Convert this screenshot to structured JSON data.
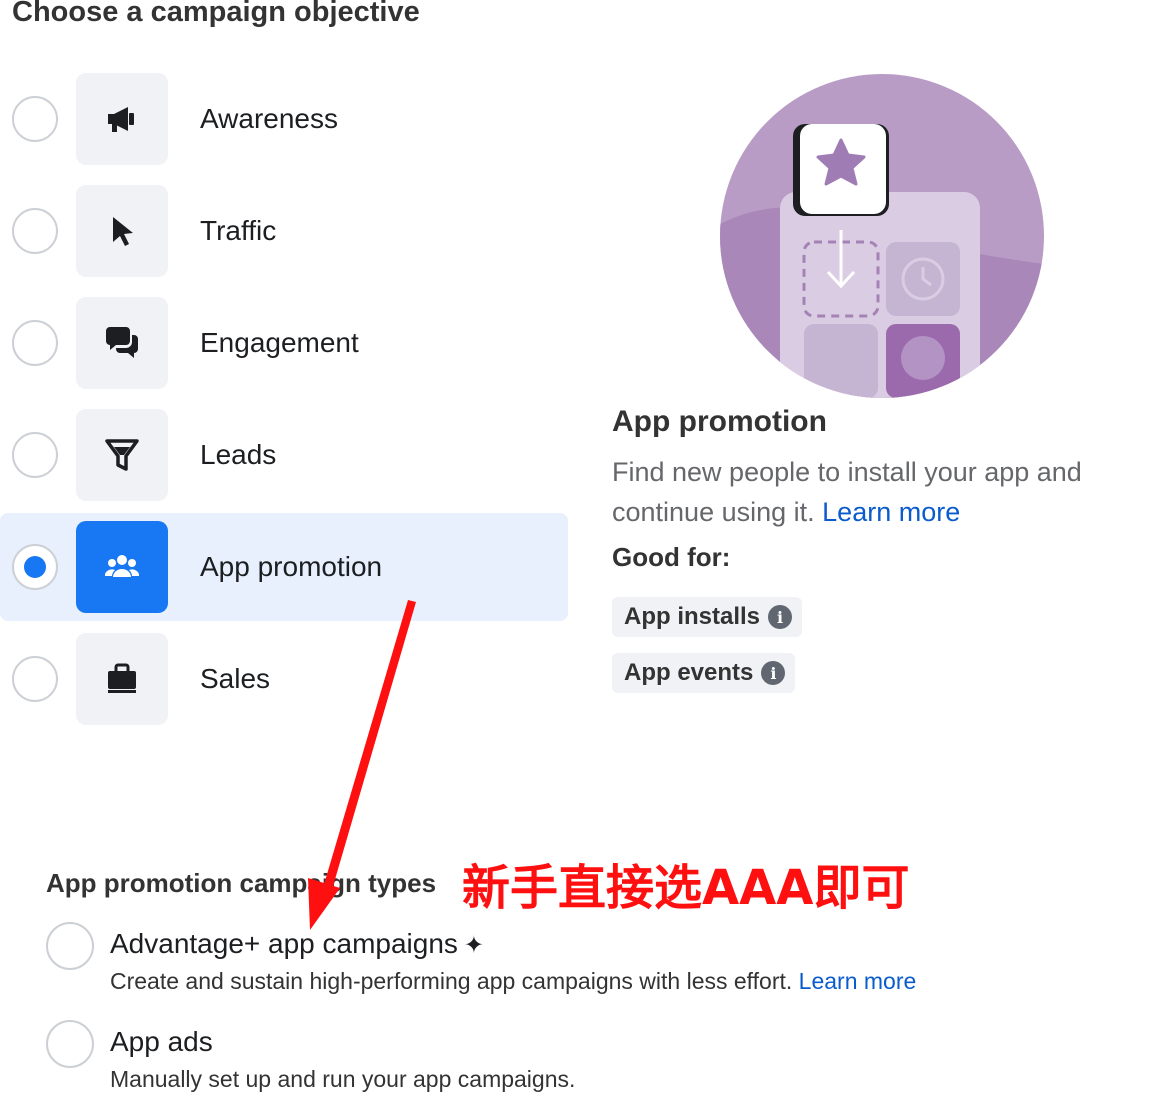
{
  "page": {
    "title": "Choose a campaign objective"
  },
  "objectives": [
    {
      "label": "Awareness",
      "icon": "megaphone-icon",
      "selected": false
    },
    {
      "label": "Traffic",
      "icon": "cursor-icon",
      "selected": false
    },
    {
      "label": "Engagement",
      "icon": "chat-bubbles-icon",
      "selected": false
    },
    {
      "label": "Leads",
      "icon": "funnel-icon",
      "selected": false
    },
    {
      "label": "App promotion",
      "icon": "people-icon",
      "selected": true
    },
    {
      "label": "Sales",
      "icon": "shopping-bag-icon",
      "selected": false
    }
  ],
  "detail": {
    "title": "App promotion",
    "description": "Find new people to install your app and continue using it.",
    "learn_more": "Learn more",
    "good_for_label": "Good for:",
    "chips": [
      {
        "label": "App installs",
        "icon": "info-icon"
      },
      {
        "label": "App events",
        "icon": "info-icon"
      }
    ]
  },
  "campaign_types": {
    "title": "App promotion campaign types",
    "annotation": "新手直接选AAA即可",
    "options": [
      {
        "title": "Advantage+ app campaigns",
        "sparkle": "✦",
        "description": "Create and sustain high-performing app campaigns with less effort.",
        "learn_more": "Learn more",
        "selected": false
      },
      {
        "title": "App ads",
        "description": "Manually set up and run your app campaigns.",
        "selected": false
      }
    ]
  },
  "colors": {
    "accent": "#1877f2",
    "selected_bg": "#e7f0fc",
    "illustration_purple": "#b89cc6",
    "annotation_red": "#ff1010"
  }
}
